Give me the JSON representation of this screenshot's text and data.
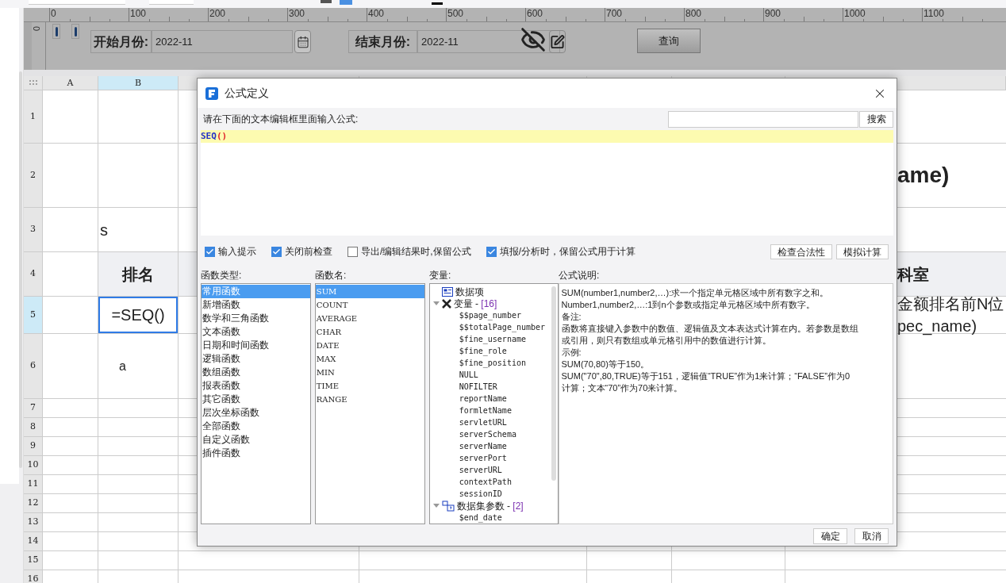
{
  "ruler": {
    "labels": [
      "0",
      "100",
      "200",
      "300",
      "400",
      "500",
      "600",
      "700",
      "800",
      "900",
      "1000",
      "1100"
    ],
    "vertical_label": "0"
  },
  "parameters": {
    "start_label": "开始月份:",
    "start_value": "2022-11",
    "end_label": "结束月份:",
    "end_value": "2022-11",
    "query_button": "查询"
  },
  "sheet": {
    "columns": [
      {
        "label": "A",
        "selected": false
      },
      {
        "label": "B",
        "selected": true
      }
    ],
    "rows": [
      {
        "number": "1",
        "selected": false,
        "header": false
      },
      {
        "number": "2",
        "selected": false,
        "header": false,
        "right_lines": [
          "ame)"
        ]
      },
      {
        "number": "3",
        "selected": false,
        "header": false,
        "b": "s"
      },
      {
        "number": "4",
        "selected": false,
        "header": true,
        "b": "排名",
        "right_lines": [
          "科室"
        ]
      },
      {
        "number": "5",
        "selected": true,
        "header": false,
        "b": "=SEQ()",
        "right_lines": [
          "金额排名前N位",
          "pec_name)"
        ]
      },
      {
        "number": "6",
        "selected": false,
        "header": false,
        "b": "a"
      },
      {
        "number": "7",
        "selected": false,
        "header": false
      },
      {
        "number": "8",
        "selected": false,
        "header": false
      },
      {
        "number": "9",
        "selected": false,
        "header": false
      },
      {
        "number": "10",
        "selected": false,
        "header": false
      },
      {
        "number": "11",
        "selected": false,
        "header": false
      },
      {
        "number": "12",
        "selected": false,
        "header": false
      },
      {
        "number": "13",
        "selected": false,
        "header": false
      },
      {
        "number": "14",
        "selected": false,
        "header": false
      },
      {
        "number": "15",
        "selected": false,
        "header": false
      },
      {
        "number": "16",
        "selected": false,
        "header": false
      }
    ]
  },
  "dialog": {
    "title": "公式定义",
    "prompt": "请在下面的文本编辑框里面输入公式:",
    "search_button": "搜索",
    "formula": {
      "function": "SEQ",
      "parens": "()"
    },
    "options": [
      {
        "label": "输入提示",
        "checked": true
      },
      {
        "label": "关闭前检查",
        "checked": true
      },
      {
        "label": "导出/编辑结果时,保留公式",
        "checked": false
      },
      {
        "label": "填报/分析时，保留公式用于计算",
        "checked": true
      }
    ],
    "action_buttons": [
      "检查合法性",
      "模拟计算"
    ],
    "function_types": {
      "label": "函数类型:",
      "items": [
        {
          "label": "常用函数",
          "selected": true
        },
        {
          "label": "新增函数",
          "selected": false
        },
        {
          "label": "数学和三角函数",
          "selected": false
        },
        {
          "label": "文本函数",
          "selected": false
        },
        {
          "label": "日期和时间函数",
          "selected": false
        },
        {
          "label": "逻辑函数",
          "selected": false
        },
        {
          "label": "数组函数",
          "selected": false
        },
        {
          "label": "报表函数",
          "selected": false
        },
        {
          "label": "其它函数",
          "selected": false
        },
        {
          "label": "层次坐标函数",
          "selected": false
        },
        {
          "label": "全部函数",
          "selected": false
        },
        {
          "label": "自定义函数",
          "selected": false
        },
        {
          "label": "插件函数",
          "selected": false
        }
      ]
    },
    "function_names": {
      "label": "函数名:",
      "items": [
        {
          "label": "SUM",
          "selected": true
        },
        {
          "label": "COUNT",
          "selected": false
        },
        {
          "label": "AVERAGE",
          "selected": false
        },
        {
          "label": "CHAR",
          "selected": false
        },
        {
          "label": "DATE",
          "selected": false
        },
        {
          "label": "MAX",
          "selected": false
        },
        {
          "label": "MIN",
          "selected": false
        },
        {
          "label": "TIME",
          "selected": false
        },
        {
          "label": "RANGE",
          "selected": false
        }
      ]
    },
    "variables": {
      "label": "变量:",
      "items": [
        {
          "kind": "data",
          "label": "数据项"
        },
        {
          "kind": "variables",
          "label": "变量 - ",
          "count": "[16]",
          "expanded": true,
          "children": [
            {
              "kind": "item",
              "label": "$$page_number"
            },
            {
              "kind": "item",
              "label": "$$totalPage_number"
            },
            {
              "kind": "item",
              "label": "$fine_username"
            },
            {
              "kind": "item",
              "label": "$fine_role"
            },
            {
              "kind": "item",
              "label": "$fine_position"
            },
            {
              "kind": "item",
              "label": "NULL"
            },
            {
              "kind": "item",
              "label": "NOFILTER"
            },
            {
              "kind": "item",
              "label": "reportName"
            },
            {
              "kind": "item",
              "label": "formletName"
            },
            {
              "kind": "item",
              "label": "servletURL"
            },
            {
              "kind": "item",
              "label": "serverSchema"
            },
            {
              "kind": "item",
              "label": "serverName"
            },
            {
              "kind": "item",
              "label": "serverPort"
            },
            {
              "kind": "item",
              "label": "serverURL"
            },
            {
              "kind": "item",
              "label": "contextPath"
            },
            {
              "kind": "item",
              "label": "sessionID"
            }
          ]
        },
        {
          "kind": "dataset",
          "label": "数据集参数 - ",
          "count": "[2]",
          "expanded": true,
          "children": [
            {
              "kind": "item",
              "label": "$end_date"
            }
          ]
        }
      ]
    },
    "description": {
      "label": "公式说明:",
      "lines": [
        "SUM(number1,number2,…):求一个指定单元格区域中所有数字之和。",
        "Number1,number2,…:1到n个参数或指定单元格区域中所有数字。",
        "备注:",
        "函数将直接键入参数中的数值、逻辑值及文本表达式计算在内。若参数是数组",
        "或引用，则只有数组或单元格引用中的数值进行计算。",
        "示例:",
        "SUM(70,80)等于150。",
        "SUM(\"70\",80,TRUE)等于151，逻辑值“TRUE”作为1来计算；“FALSE”作为0",
        "计算；文本“70”作为70来计算。"
      ]
    },
    "footer_buttons": [
      "确定",
      "取消"
    ]
  }
}
